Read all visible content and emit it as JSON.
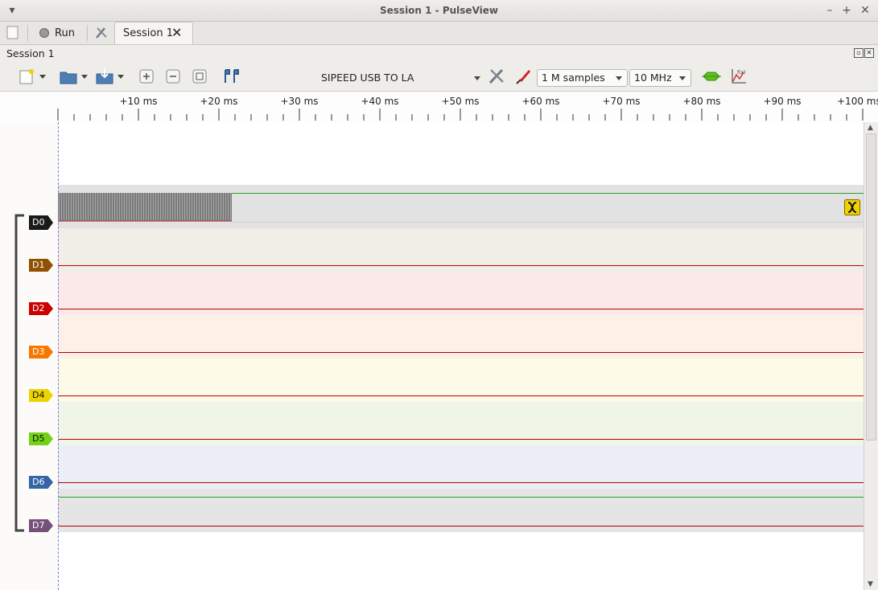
{
  "window": {
    "title": "Session 1 - PulseView"
  },
  "tabs": {
    "run_label": "Run",
    "session_tab_label": "Session 1"
  },
  "session": {
    "label": "Session 1"
  },
  "toolbar": {
    "device": "SIPEED USB TO LA",
    "samples": "1 M samples",
    "rate": "10 MHz"
  },
  "ruler": {
    "ticks": [
      "+10 ms",
      "+20 ms",
      "+30 ms",
      "+40 ms",
      "+50 ms",
      "+60 ms",
      "+70 ms",
      "+80 ms",
      "+90 ms",
      "+100 ms"
    ]
  },
  "channels": [
    {
      "label": "D0",
      "color": "#1a1a1a",
      "band": "#e2e2e2"
    },
    {
      "label": "D1",
      "color": "#8f5202",
      "band": "#f1eee8"
    },
    {
      "label": "D2",
      "color": "#cc0000",
      "band": "#fbe8e8"
    },
    {
      "label": "D3",
      "color": "#f57900",
      "band": "#fdf0e6"
    },
    {
      "label": "D4",
      "color": "#edd400",
      "band": "#fdfbe7"
    },
    {
      "label": "D5",
      "color": "#73d216",
      "band": "#eff6e8"
    },
    {
      "label": "D6",
      "color": "#3465a4",
      "band": "#ebeef4"
    },
    {
      "label": "D7",
      "color": "#75507b",
      "band": "#e6e5e5"
    }
  ]
}
